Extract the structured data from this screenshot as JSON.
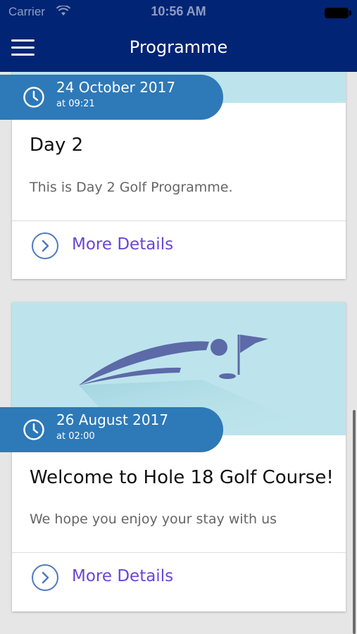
{
  "status_bar": {
    "carrier": "Carrier",
    "time": "10:56 AM"
  },
  "nav": {
    "title": "Programme"
  },
  "events": [
    {
      "date": "24 October 2017",
      "time": "at 09:21",
      "title": "Day 2",
      "description": "This is Day 2 Golf Programme.",
      "link_label": "More Details"
    },
    {
      "date": "26 August 2017",
      "time": "at 02:00",
      "title": "Welcome to Hole 18 Golf Course!",
      "description": "We hope you enjoy your stay with us",
      "link_label": "More Details"
    }
  ],
  "colors": {
    "header": "#022474",
    "date_pill": "#2e79b8",
    "link": "#6a45d6",
    "image_bg": "#bde4ec"
  }
}
